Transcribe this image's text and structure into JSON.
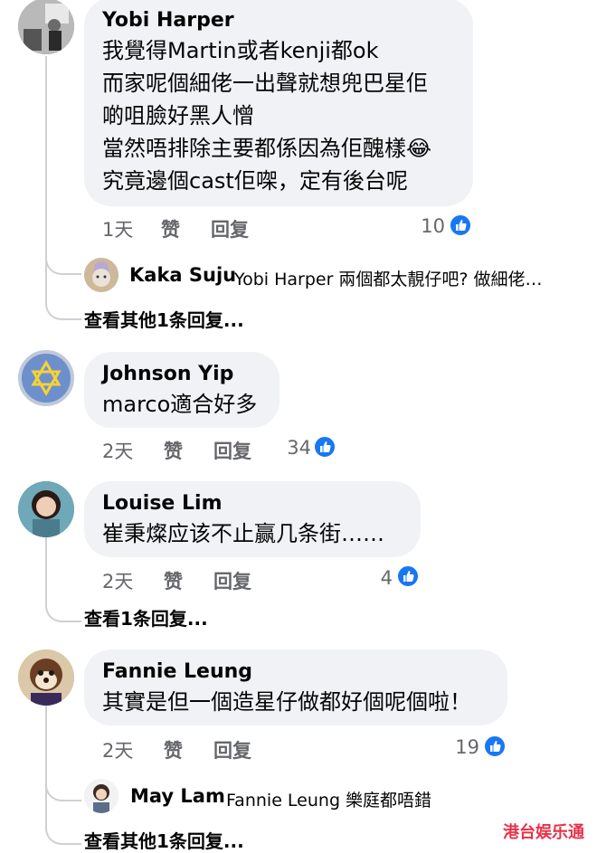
{
  "comments": [
    {
      "author": "Yobi Harper",
      "lines": [
        "我覺得Martin或者kenji都ok",
        "而家呢個細佬一出聲就想兜巴星佢",
        "啲咀臉好黑人憎",
        "當然唔排除主要都係因為佢醜樣😂",
        "究竟邊個cast佢㗎，定有後台呢"
      ],
      "time": "1天",
      "like_label": "赞",
      "reply_label": "回复",
      "likes": "10",
      "reply_preview": {
        "author": "Kaka Suju",
        "text": "Yobi Harper 兩個都太靚仔吧? 做細佬…"
      },
      "view_more": "查看其他1条回复..."
    },
    {
      "author": "Johnson Yip",
      "lines": [
        "marco適合好多"
      ],
      "time": "2天",
      "like_label": "赞",
      "reply_label": "回复",
      "likes": "34"
    },
    {
      "author": "Louise Lim",
      "lines": [
        "崔秉燦应该不止赢几条街……"
      ],
      "time": "2天",
      "like_label": "赞",
      "reply_label": "回复",
      "likes": "4",
      "view_more": "查看1条回复..."
    },
    {
      "author": "Fannie Leung",
      "lines": [
        "其實是但一個造星仔做都好個呢個啦！"
      ],
      "time": "2天",
      "like_label": "赞",
      "reply_label": "回复",
      "likes": "19",
      "reply_preview": {
        "author": "May Lam",
        "text": "Fannie Leung 樂庭都唔錯"
      },
      "view_more": "查看其他1条回复..."
    }
  ],
  "watermark": "港台娱乐通",
  "colors": {
    "bubble": "#f0f2f5",
    "meta": "#65676b",
    "like_blue": "#1877f2",
    "thread": "#ced0d4"
  }
}
